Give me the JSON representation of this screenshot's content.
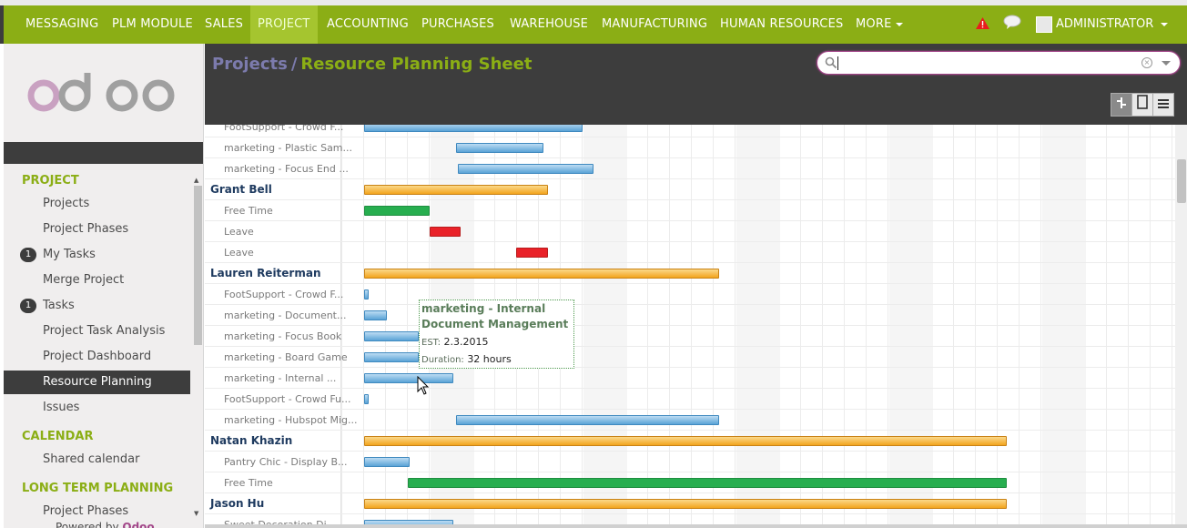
{
  "topnav": {
    "items": [
      "MESSAGING",
      "PLM MODULE",
      "SALES",
      "PROJECT",
      "ACCOUNTING",
      "PURCHASES",
      "WAREHOUSE",
      "MANUFACTURING",
      "HUMAN RESOURCES",
      "MORE"
    ],
    "active": "PROJECT",
    "user": "ADMINISTRATOR",
    "colors": {
      "bar": "#8bae15",
      "active": "#a5c52f"
    }
  },
  "sidebar": {
    "logo": "odoo",
    "sections": [
      {
        "title": "PROJECT",
        "items": [
          {
            "label": "Projects"
          },
          {
            "label": "Project Phases"
          },
          {
            "label": "My Tasks",
            "badge": "1"
          },
          {
            "label": "Merge Project"
          },
          {
            "label": "Tasks",
            "badge": "1"
          },
          {
            "label": "Project Task Analysis"
          },
          {
            "label": "Project Dashboard"
          },
          {
            "label": "Resource Planning",
            "active": true
          },
          {
            "label": "Issues"
          }
        ]
      },
      {
        "title": "CALENDAR",
        "items": [
          {
            "label": "Shared calendar"
          }
        ]
      },
      {
        "title": "LONG TERM PLANNING",
        "items": [
          {
            "label": "Project Phases"
          }
        ]
      }
    ],
    "powered_prefix": "Powered by",
    "powered_brand": "Odoo"
  },
  "header": {
    "breadcrumb_parent": "Projects",
    "breadcrumb_sep": "/",
    "breadcrumb_current": "Resource Planning Sheet",
    "search_value": ""
  },
  "gantt": {
    "rows": [
      {
        "name": "FootSupport - Crowd F...",
        "group": false,
        "bars": [
          {
            "color": "blue",
            "start": 0,
            "len": 10
          }
        ]
      },
      {
        "name": "marketing - Plastic Sam...",
        "group": false,
        "bars": [
          {
            "color": "blue",
            "start": 4.2,
            "len": 4
          }
        ]
      },
      {
        "name": "marketing - Focus End ...",
        "group": false,
        "bars": [
          {
            "color": "blue",
            "start": 4.3,
            "len": 6.2
          }
        ]
      },
      {
        "name": "Grant Bell",
        "group": true,
        "bars": [
          {
            "color": "orange",
            "start": 0,
            "len": 8.4
          }
        ]
      },
      {
        "name": "Free Time",
        "group": false,
        "bars": [
          {
            "color": "green",
            "start": 0,
            "len": 3
          }
        ]
      },
      {
        "name": "Leave",
        "group": false,
        "bars": [
          {
            "color": "red",
            "start": 3,
            "len": 1.4
          }
        ]
      },
      {
        "name": "Leave",
        "group": false,
        "bars": [
          {
            "color": "red",
            "start": 6.95,
            "len": 1.45
          }
        ]
      },
      {
        "name": "Lauren Reiterman",
        "group": true,
        "bars": [
          {
            "color": "orange",
            "start": 0,
            "len": 16.25
          }
        ]
      },
      {
        "name": "FootSupport - Crowd F...",
        "group": false,
        "bars": [
          {
            "color": "blue",
            "start": 0,
            "len": 0.2
          }
        ]
      },
      {
        "name": "marketing - Document...",
        "group": false,
        "bars": [
          {
            "color": "blue",
            "start": 0,
            "len": 1.05
          }
        ]
      },
      {
        "name": "marketing - Focus Book",
        "group": false,
        "bars": [
          {
            "color": "blue",
            "start": 0,
            "len": 2.5
          }
        ]
      },
      {
        "name": "marketing - Board Game",
        "group": false,
        "bars": [
          {
            "color": "blue",
            "start": 0,
            "len": 2.5
          }
        ]
      },
      {
        "name": "marketing - Internal ...",
        "group": false,
        "bars": [
          {
            "color": "blue",
            "start": 0,
            "len": 4.1
          }
        ]
      },
      {
        "name": "FootSupport - Crowd Fu...",
        "group": false,
        "bars": [
          {
            "color": "blue",
            "start": 0,
            "len": 0.2
          }
        ]
      },
      {
        "name": "marketing - Hubspot Mig...",
        "group": false,
        "bars": [
          {
            "color": "blue",
            "start": 4.2,
            "len": 12.05
          }
        ]
      },
      {
        "name": "Natan Khazin",
        "group": true,
        "bars": [
          {
            "color": "orange",
            "start": 0,
            "len": 29.4
          }
        ]
      },
      {
        "name": "Pantry Chic - Display B...",
        "group": false,
        "bars": [
          {
            "color": "blue",
            "start": 0,
            "len": 2.1
          }
        ]
      },
      {
        "name": "Free Time",
        "group": false,
        "bars": [
          {
            "color": "green",
            "start": 2,
            "len": 27.4
          }
        ]
      },
      {
        "name": "Jason Hu",
        "group": true,
        "bars": [
          {
            "color": "orange",
            "start": 0,
            "len": 29.4
          }
        ]
      },
      {
        "name": "Sweet Decoration Di...",
        "group": false,
        "bars": [
          {
            "color": "blue",
            "start": 0,
            "len": 4.1
          }
        ]
      }
    ],
    "tooltip": {
      "title": "marketing - Internal Document Management",
      "est_label": "EST:",
      "est_value": "2.3.2015",
      "duration_label": "Duration:",
      "duration_value": "32 hours"
    }
  }
}
